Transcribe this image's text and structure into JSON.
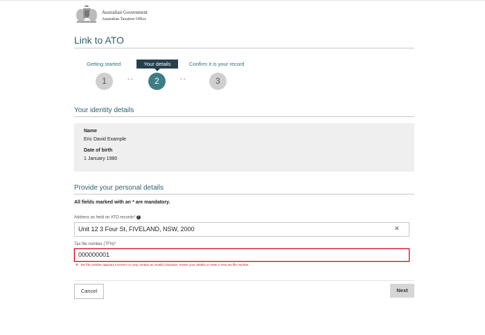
{
  "header": {
    "logo_line1": "Australian Government",
    "logo_line2": "Australian Taxation Office",
    "page_title": "Link to ATO"
  },
  "stepper": {
    "steps": [
      {
        "label": "Getting started",
        "number": "1",
        "state": "complete"
      },
      {
        "label": "Your details",
        "number": "2",
        "state": "active"
      },
      {
        "label": "Confirm it is your record",
        "number": "3",
        "state": "upcoming"
      }
    ]
  },
  "identity": {
    "title": "Your identity details",
    "name_label": "Name",
    "name_value": "Eric David Example",
    "dob_label": "Date of birth",
    "dob_value": "1 January 1980"
  },
  "personal": {
    "title": "Provide your personal details",
    "mandatory_note": "All fields marked with an * are mandatory.",
    "address_label": "Address as held on ATO records*",
    "address_value": "Unit 12   3 Four St, FIVELAND, NSW, 2000",
    "tfn_label": "Tax file number (TFN)*",
    "tfn_value": "000000001",
    "tfn_error": "Tax file number appears incorrect or may contain an invalid character, review your details or enter a new tax file number."
  },
  "actions": {
    "cancel_label": "Cancel",
    "next_label": "Next"
  },
  "colors": {
    "accent": "#3f7d86",
    "active_tab": "#26414e",
    "error": "#d0021b"
  }
}
